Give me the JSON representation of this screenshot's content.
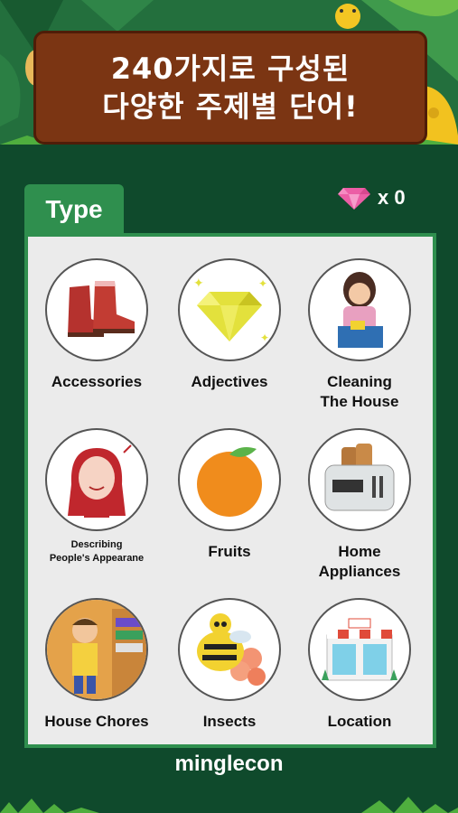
{
  "banner": {
    "line1": "240가지로 구성된",
    "line2": "다양한 주제별 단어!"
  },
  "type_tab": {
    "label": "Type"
  },
  "gems": {
    "icon": "gem-icon",
    "count_label": "x 0",
    "color": "#e85aa0"
  },
  "categories": [
    {
      "label": "Accessories",
      "icon": "boots-icon"
    },
    {
      "label": "Adjectives",
      "icon": "diamond-icon"
    },
    {
      "label": "Cleaning\nThe House",
      "icon": "cleaning-woman-icon"
    },
    {
      "label": "Describing\nPeople's Appearane",
      "icon": "red-hair-woman-icon"
    },
    {
      "label": "Fruits",
      "icon": "orange-icon"
    },
    {
      "label": "Home\nAppliances",
      "icon": "toaster-icon"
    },
    {
      "label": "House Chores",
      "icon": "boy-closet-icon"
    },
    {
      "label": "Insects",
      "icon": "bee-icon"
    },
    {
      "label": "Location",
      "icon": "storefront-icon"
    }
  ],
  "brand": {
    "name": "minglecon"
  },
  "colors": {
    "background": "#0f4a2c",
    "panel": "#2f8f4e",
    "banner": "#7b3513"
  }
}
